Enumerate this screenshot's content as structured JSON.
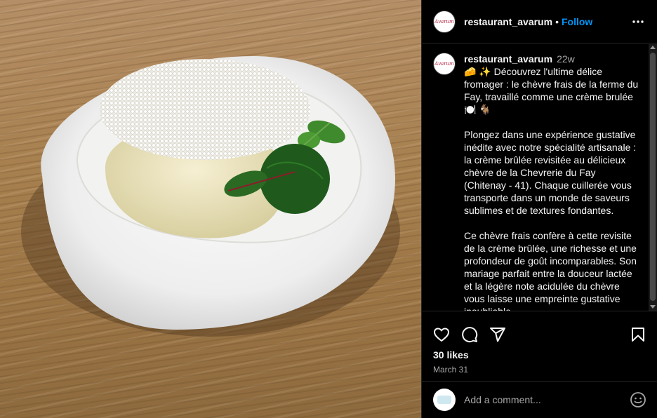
{
  "post": {
    "username": "restaurant_avarum",
    "follow_label": "Follow",
    "separator": "•",
    "logo_text": "Avarum"
  },
  "caption": {
    "username": "restaurant_avarum",
    "time": "22w",
    "text": "🧀 ✨ Découvrez l'ultime délice fromager : le chèvre frais de la ferme du Fay, travaillé comme une crème brulée 🍽️ 🐐\n\nPlongez dans une expérience gustative inédite avec notre spécialité artisanale : la crème brûlée revisitée au délicieux chèvre de la Chevrerie du Fay (Chitenay - 41). Chaque cuillerée vous transporte dans un monde de saveurs sublimes et de textures fondantes.\n\nCe chèvre frais confère à cette revisite de la crème brûlée, une richesse et une profondeur de goût incomparables. Son mariage parfait entre la douceur lactée et la légère note acidulée du chèvre vous laisse une empreinte gustative inoubliable."
  },
  "actions": {
    "likes": "30 likes",
    "date": "March 31"
  },
  "comment": {
    "placeholder": "Add a comment..."
  },
  "icons": {
    "like": "heart-icon",
    "comment": "comment-icon",
    "share": "send-icon",
    "save": "bookmark-icon",
    "more": "more-icon",
    "emoji": "emoji-icon"
  },
  "colors": {
    "accent": "#0095f6",
    "background": "#000000",
    "secondary_text": "#a8a8a8"
  }
}
